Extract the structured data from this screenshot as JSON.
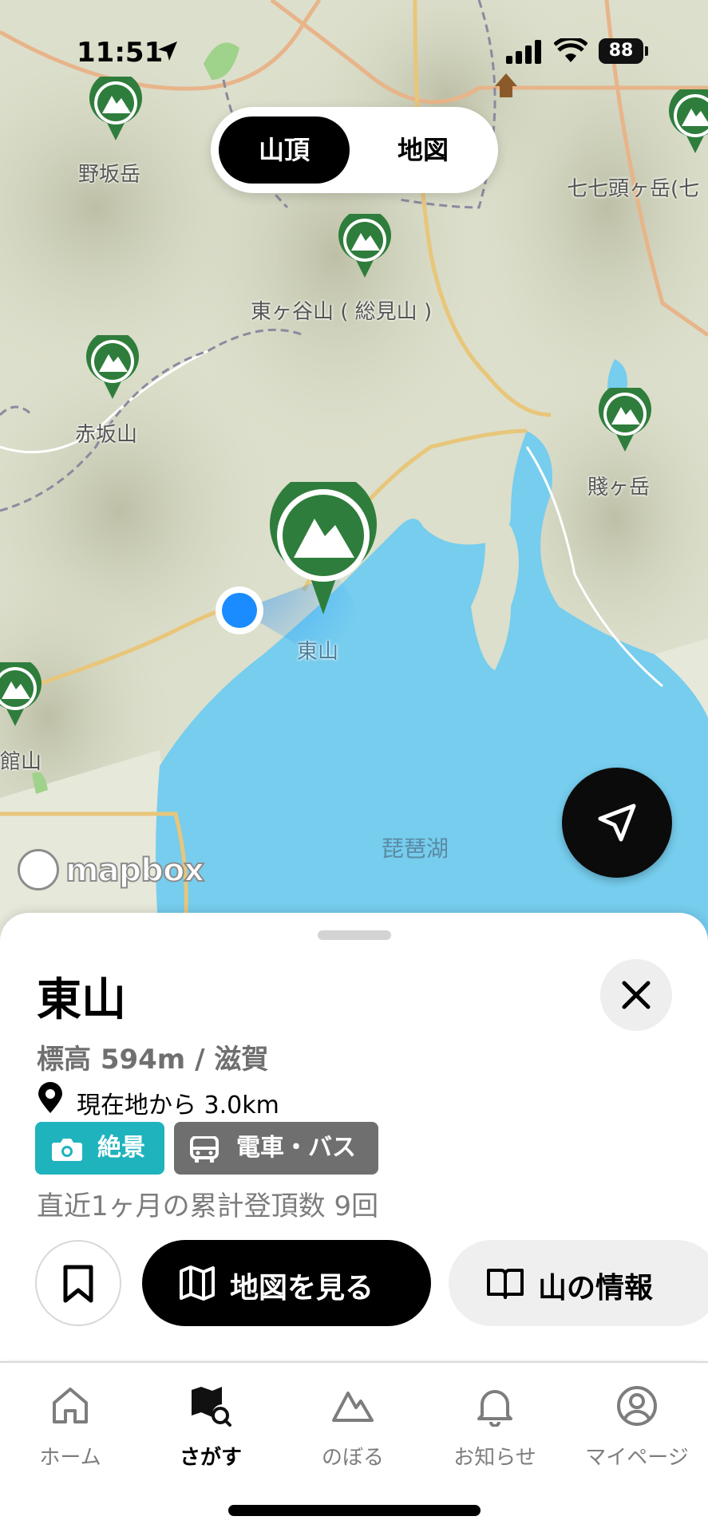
{
  "status_bar": {
    "time": "11:51",
    "battery": "88"
  },
  "segment": {
    "options": [
      "山頂",
      "地図"
    ],
    "selected": "山頂"
  },
  "map": {
    "labels": {
      "nosaka": "野坂岳",
      "nanananto": "七七頭ヶ岳(七",
      "higashigatani": "東ヶ谷山 ( 総見山 )",
      "akasaka": "赤坂山",
      "shizugatake": "賤ヶ岳",
      "higashiyama": "東山",
      "yakata": "館山",
      "lake": "琵琶湖"
    },
    "attribution": "mapbox",
    "colors": {
      "water": "#76cdee",
      "terrain": "#d9dcc8",
      "pin": "#2f7d3c",
      "user_location": "#1a8cff"
    }
  },
  "sheet": {
    "title": "東山",
    "elevation": "標高 594m / 滋賀",
    "distance": "現在地から 3.0km",
    "tags": [
      "絶景",
      "電車・バス"
    ],
    "summit_count": "直近1ヶ月の累計登頂数 9回",
    "buttons": {
      "view_map": "地図を見る",
      "mountain_info": "山の情報"
    }
  },
  "tabbar": {
    "items": [
      "ホーム",
      "さがす",
      "のぼる",
      "お知らせ",
      "マイページ"
    ],
    "active": "さがす"
  }
}
